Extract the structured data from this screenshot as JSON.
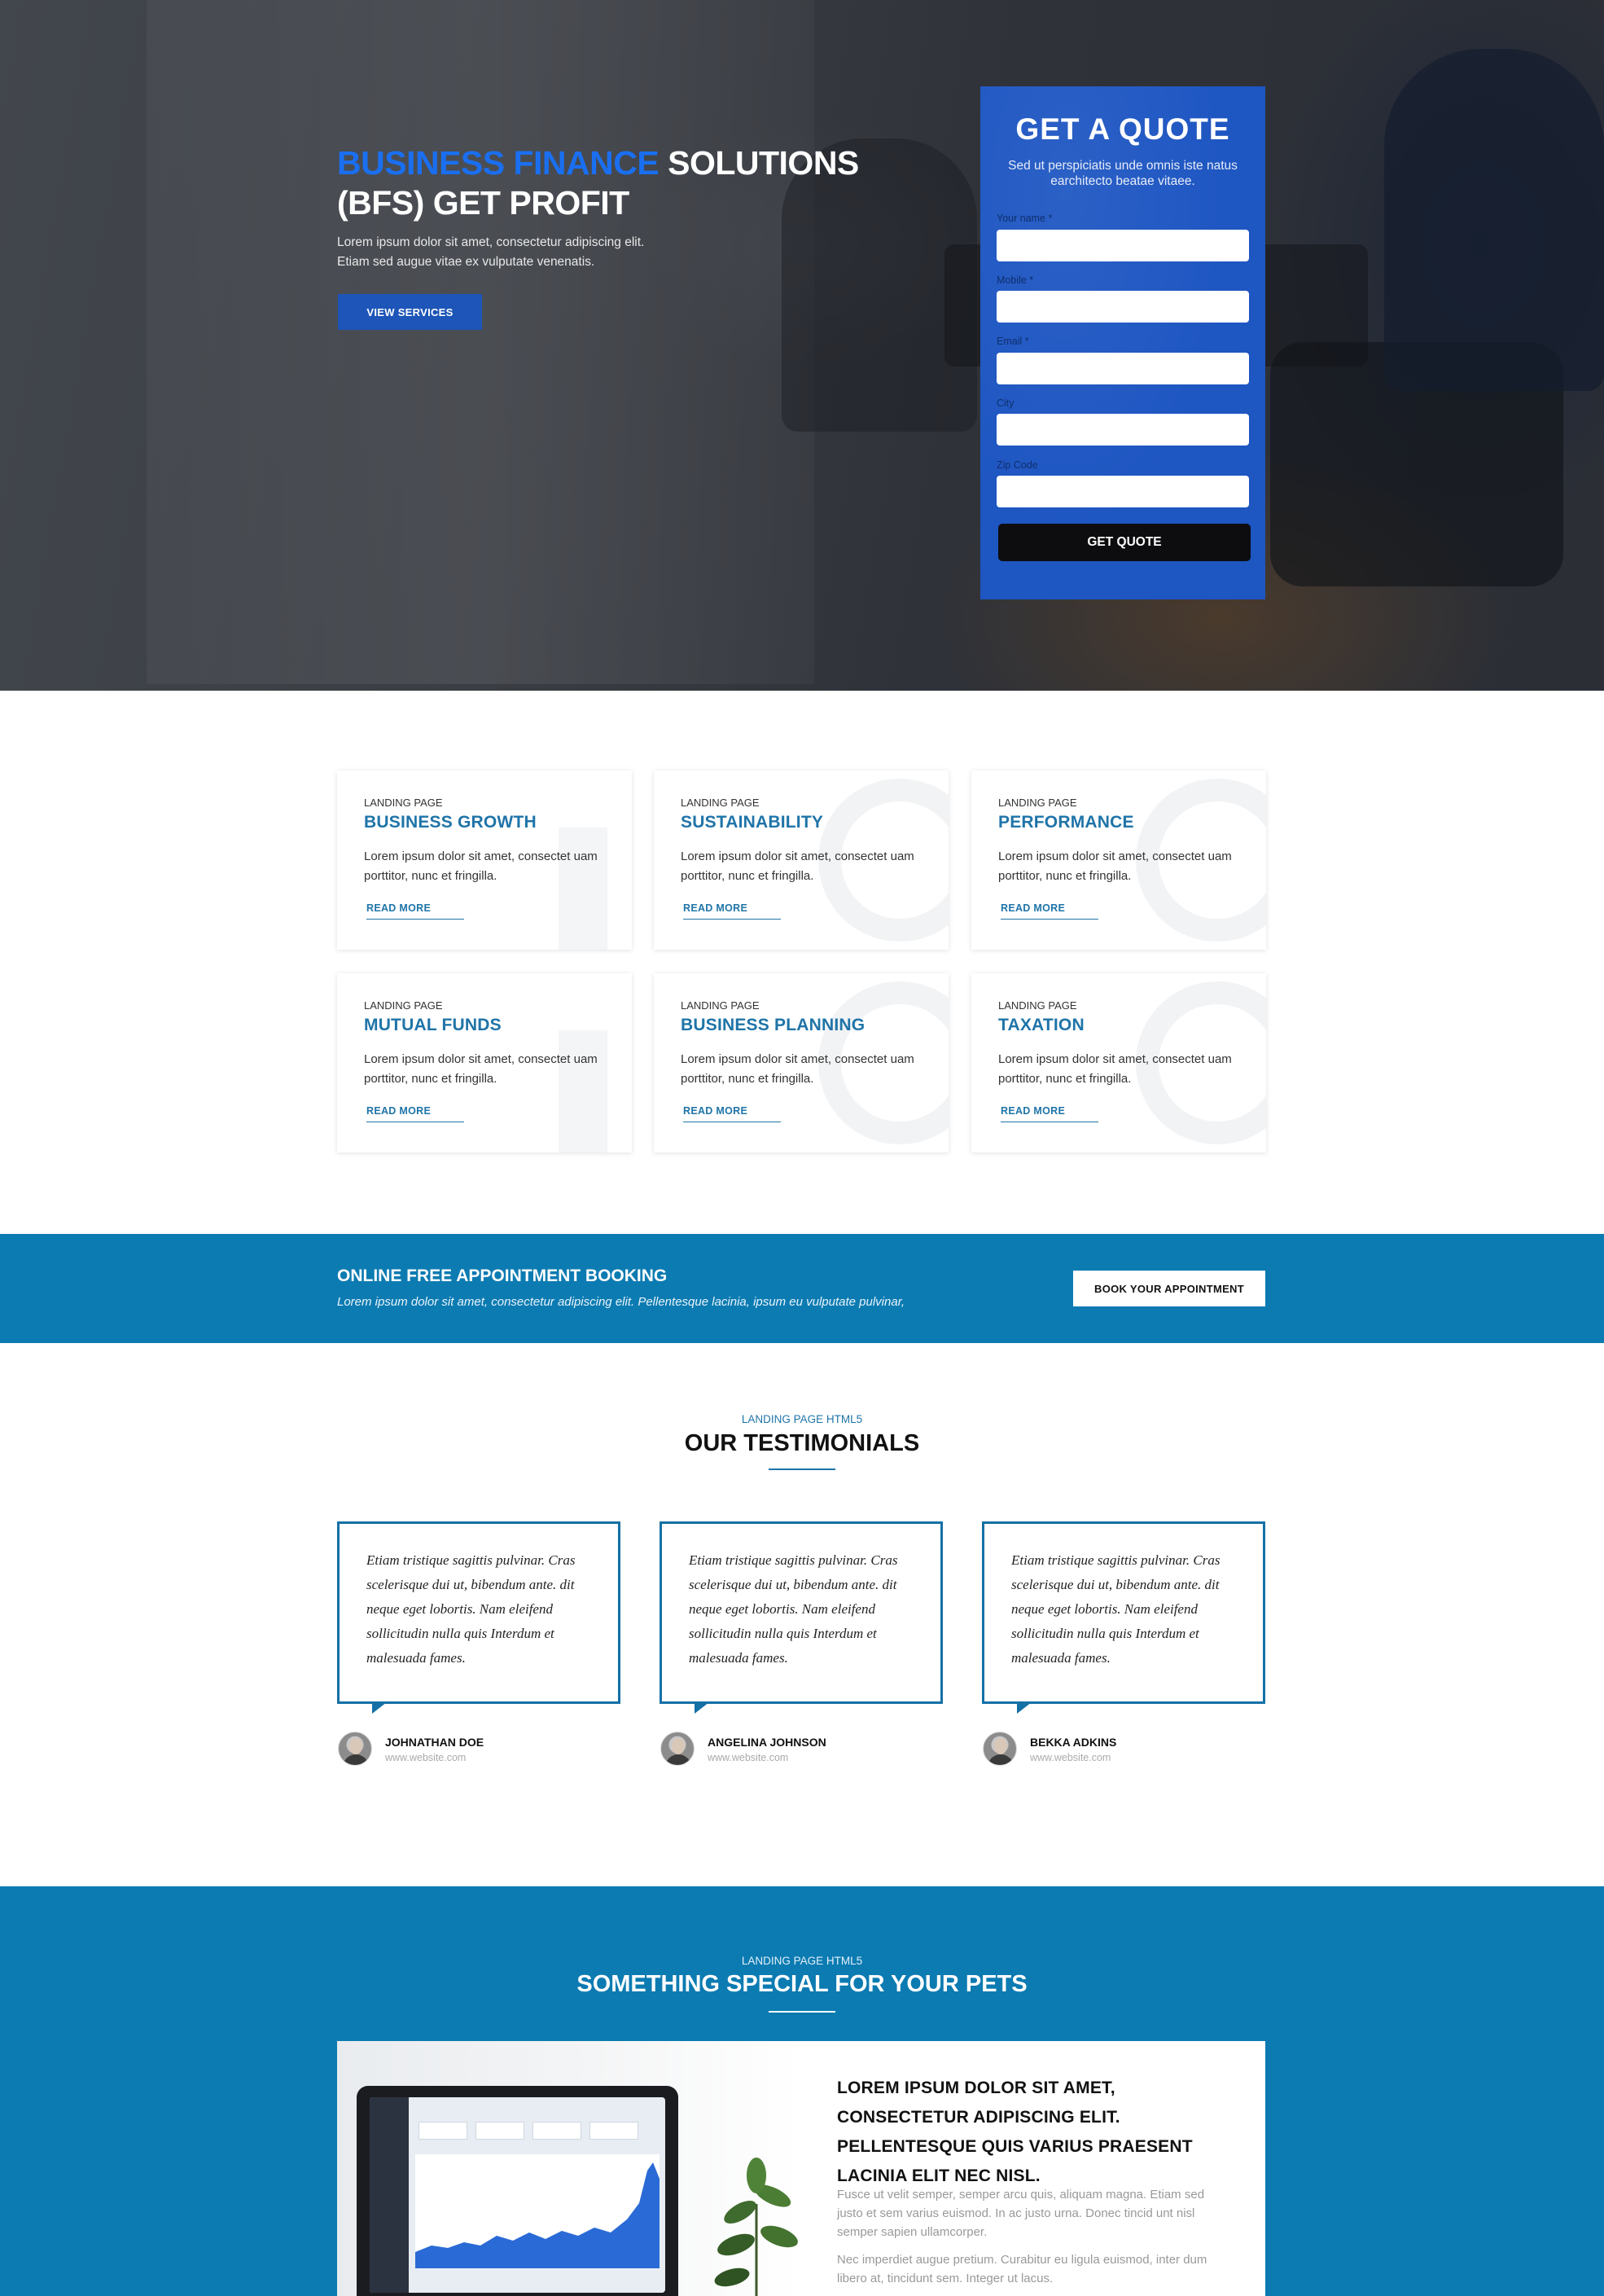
{
  "hero": {
    "title_accent": "BUSINESS FINANCE",
    "title_rest": " SOLUTIONS",
    "title_line2": "(BFS) GET PROFIT",
    "subtitle_line1": "Lorem ipsum dolor sit amet, consectetur adipiscing elit.",
    "subtitle_line2": "Etiam sed augue vitae ex vulputate venenatis.",
    "cta_label": "VIEW SERVICES"
  },
  "quote_form": {
    "title": "GET A QUOTE",
    "subtitle": "Sed ut perspiciatis unde omnis iste natus earchitecto beatae vitaee.",
    "fields": [
      {
        "label": "Your name *",
        "value": ""
      },
      {
        "label": "Mobile *",
        "value": ""
      },
      {
        "label": "Email *",
        "value": ""
      },
      {
        "label": "City",
        "value": ""
      },
      {
        "label": "Zip Code",
        "value": ""
      }
    ],
    "submit_label": "GET QUOTE"
  },
  "services": [
    {
      "kicker": "LANDING PAGE",
      "title": "BUSINESS GROWTH",
      "desc": "Lorem ipsum dolor sit amet, consectet uam porttitor, nunc et fringilla.",
      "link": "READ MORE"
    },
    {
      "kicker": "LANDING PAGE",
      "title": "SUSTAINABILITY",
      "desc": "Lorem ipsum dolor sit amet, consectet uam porttitor, nunc et fringilla.",
      "link": "READ MORE"
    },
    {
      "kicker": "LANDING PAGE",
      "title": "PERFORMANCE",
      "desc": "Lorem ipsum dolor sit amet, consectet uam porttitor, nunc et fringilla.",
      "link": "READ MORE"
    },
    {
      "kicker": "LANDING PAGE",
      "title": "MUTUAL FUNDS",
      "desc": "Lorem ipsum dolor sit amet, consectet uam porttitor, nunc et fringilla.",
      "link": "READ MORE"
    },
    {
      "kicker": "LANDING PAGE",
      "title": "BUSINESS PLANNING",
      "desc": "Lorem ipsum dolor sit amet, consectet uam porttitor, nunc et fringilla.",
      "link": "READ MORE"
    },
    {
      "kicker": "LANDING PAGE",
      "title": "TAXATION",
      "desc": "Lorem ipsum dolor sit amet, consectet uam porttitor, nunc et fringilla.",
      "link": "READ MORE"
    }
  ],
  "booking": {
    "title": "ONLINE FREE APPOINTMENT BOOKING",
    "subtitle": "Lorem ipsum dolor sit amet, consectetur adipiscing elit. Pellentesque lacinia, ipsum eu vulputate pulvinar,",
    "button_label": "BOOK YOUR APPOINTMENT"
  },
  "testimonials": {
    "kicker": "LANDING PAGE HTML5",
    "title": "OUR TESTIMONIALS",
    "items": [
      {
        "text": "Etiam tristique sagittis pulvinar. Cras scelerisque dui ut, bibendum ante. dit neque eget lobortis. Nam eleifend sollicitudin nulla quis Interdum et malesuada fames.",
        "name": "JOHNATHAN DOE",
        "site": "www.website.com"
      },
      {
        "text": "Etiam tristique sagittis pulvinar. Cras scelerisque dui ut, bibendum ante. dit neque eget lobortis. Nam eleifend sollicitudin nulla quis Interdum et malesuada fames.",
        "name": "ANGELINA JOHNSON",
        "site": "www.website.com"
      },
      {
        "text": "Etiam tristique sagittis pulvinar. Cras scelerisque dui ut, bibendum ante. dit neque eget lobortis. Nam eleifend sollicitudin nulla quis Interdum et malesuada fames.",
        "name": "BEKKA ADKINS",
        "site": "www.website.com"
      }
    ]
  },
  "pets": {
    "kicker": "LANDING PAGE HTML5",
    "title": "SOMETHING SPECIAL FOR YOUR PETS",
    "heading": "LOREM IPSUM DOLOR SIT AMET, CONSECTETUR ADIPISCING ELIT. PELLENTESQUE QUIS VARIUS PRAESENT LACINIA ELIT NEC NISL.",
    "para1": "Fusce ut velit semper, semper arcu quis, aliquam magna. Etiam sed justo et sem varius euismod. In ac justo urna. Donec tincid unt nisl semper sapien ullamcorper.",
    "para2": "Nec imperdiet augue pretium. Curabitur eu ligula euismod, inter dum libero at, tincidunt sem. Integer ut lacus."
  },
  "colors": {
    "brand_blue": "#1e56c2",
    "accent_blue": "#1a6ff0",
    "section_blue": "#0c7bb2",
    "link_blue": "#1f74a8"
  }
}
